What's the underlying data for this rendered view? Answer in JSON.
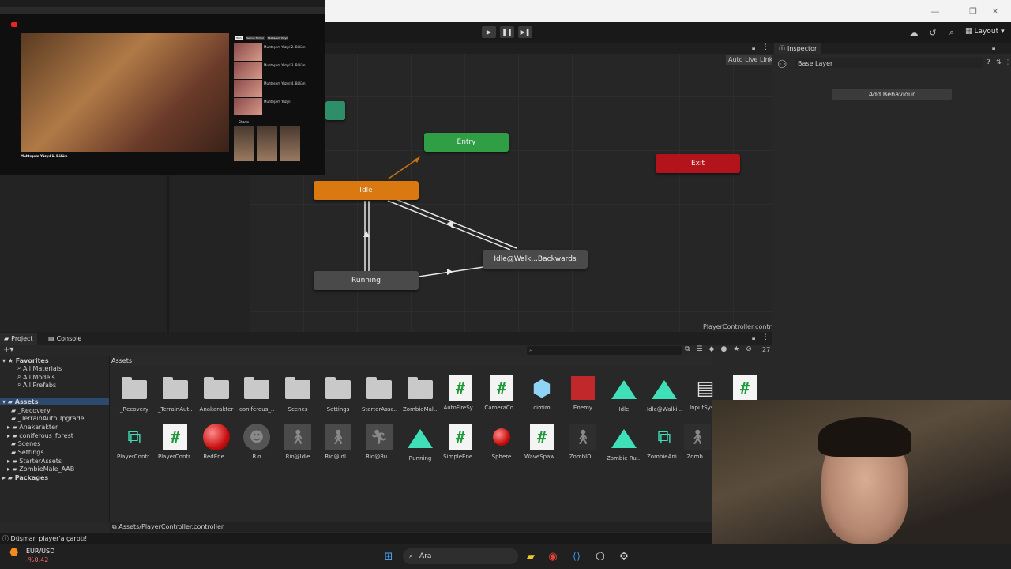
{
  "window": {
    "controls": [
      "—",
      "❐",
      "✕"
    ]
  },
  "toolbar": {
    "play": "▶",
    "pause": "❚❚",
    "step": "▶❚",
    "layout_label": "Layout"
  },
  "animator": {
    "auto_live_link": "Auto Live Link",
    "controller_file": "PlayerController.controller",
    "states": {
      "entry": "Entry",
      "exit": "Exit",
      "idle": "Idle",
      "running": "Running",
      "walk_back": "Idle@Walk...Backwards"
    },
    "colors": {
      "entry": "#2f9e45",
      "exit": "#b3141c",
      "idle": "#d9790f",
      "default": "#4a4a4a",
      "teal": "#2f8e6a"
    }
  },
  "inspector": {
    "tab_label": "Inspector",
    "layer_name": "Base Layer",
    "add_behaviour": "Add Behaviour"
  },
  "project": {
    "tabs": [
      "Project",
      "Console"
    ],
    "count_badge": "27",
    "assets_header": "Assets",
    "path": "Assets/PlayerController.controller",
    "tree": {
      "favorites": "Favorites",
      "fav_items": [
        "All Materials",
        "All Models",
        "All Prefabs"
      ],
      "assets": "Assets",
      "asset_items": [
        "_Recovery",
        "_TerrainAutoUpgrade",
        "Anakarakter",
        "coniferous_forest",
        "Scenes",
        "Settings",
        "StarterAssets",
        "ZombieMale_AAB"
      ],
      "packages": "Packages"
    },
    "row1": [
      "_Recovery",
      "_TerrainAut...",
      "Anakarakter",
      "coniferous_...",
      "Scenes",
      "Settings",
      "StarterAsse...",
      "ZombieMal...",
      "AutoFireSy...",
      "CameraCo...",
      "cimim",
      "Enemy",
      "Idle",
      "Idle@Walki...",
      "InputSyst..."
    ],
    "row2": [
      "PlayerContr...",
      "PlayerContr...",
      "RedEne...",
      "Rio",
      "Rio@Idle",
      "Rio@Idl...",
      "Rio@Ru...",
      "Running",
      "SimpleEne...",
      "Sphere",
      "WaveSpaw...",
      "ZombID...",
      "Zombie Ru...",
      "ZombieAni...",
      "Zomb..."
    ]
  },
  "console_message": "Düşman player'a çarptı!",
  "taskbar": {
    "ticker_name": "EUR/USD",
    "ticker_value": "-%0,42",
    "search_placeholder": "Ara"
  },
  "browser": {
    "title": "Muhteşem Yüzyıl 1. Bölüm",
    "tags": [
      "Tümü",
      "Serinin filmleri",
      "Muhteşem Yüzyıl"
    ],
    "shorts_label": "Shorts",
    "sidebar_items": [
      "Muhteşem Yüzyıl 2. Bölüm",
      "Muhteşem Yüzyıl 3. Bölüm",
      "Muhteşem Yüzyıl 4. Bölüm",
      "Muhteşem Yüzyıl",
      "Muhteşem Yüzyıl 5. Bölüm"
    ]
  }
}
